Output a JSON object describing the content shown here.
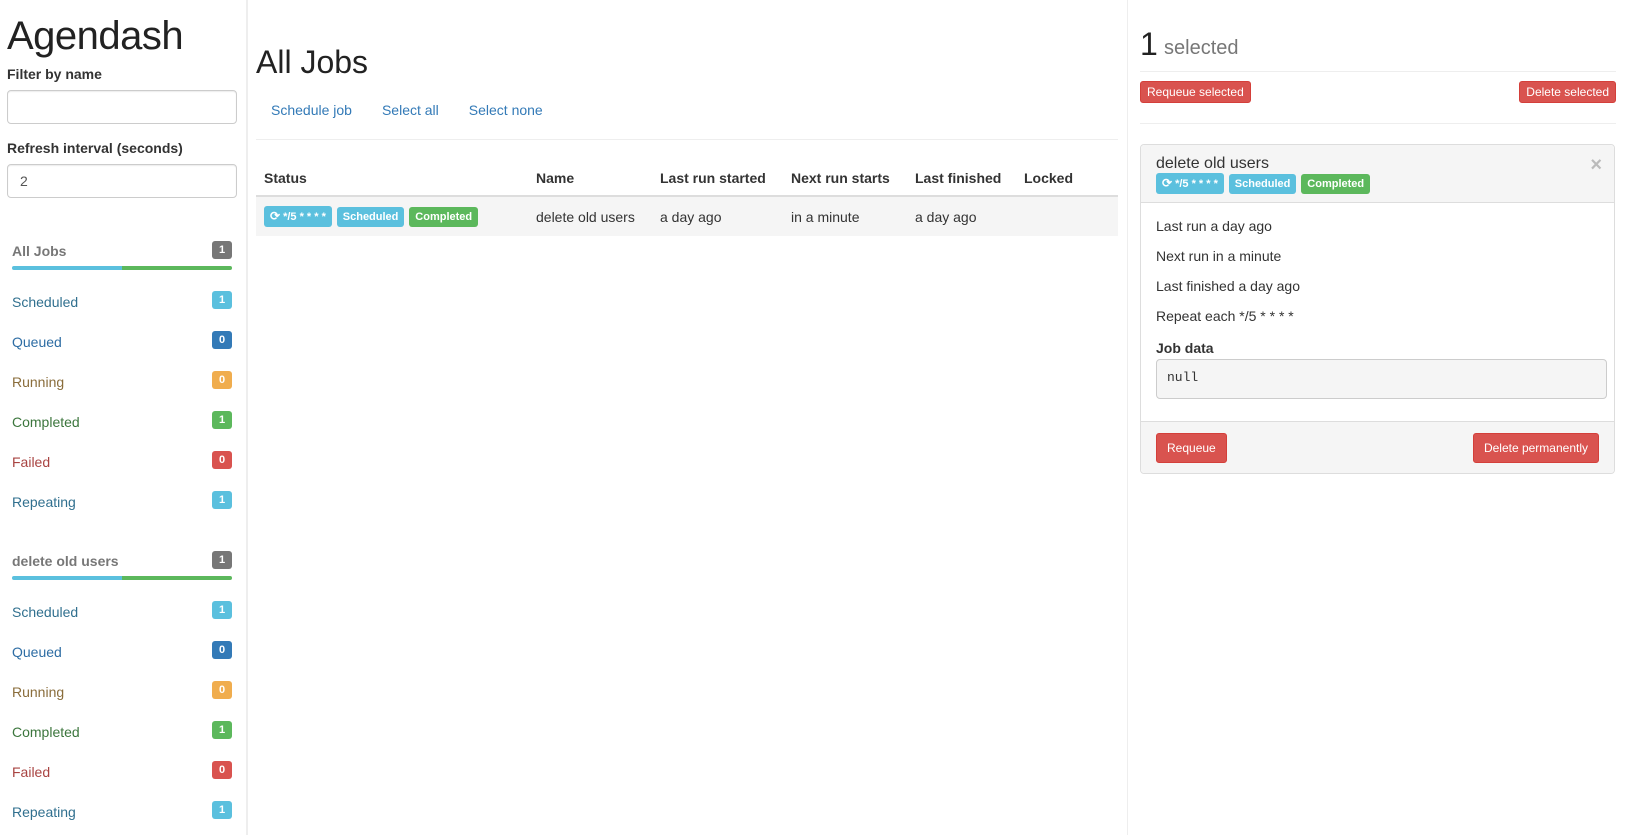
{
  "sidebar": {
    "brand": "Agendash",
    "filter_label": "Filter by name",
    "filter_value": "",
    "refresh_label": "Refresh interval (seconds)",
    "refresh_value": "2",
    "groups": [
      {
        "title": "All Jobs",
        "count": "1",
        "progress": {
          "scheduled": 0.5,
          "completed": 0.5
        },
        "statuses": [
          {
            "label": "Scheduled",
            "count": "1"
          },
          {
            "label": "Queued",
            "count": "0"
          },
          {
            "label": "Running",
            "count": "0"
          },
          {
            "label": "Completed",
            "count": "1"
          },
          {
            "label": "Failed",
            "count": "0"
          },
          {
            "label": "Repeating",
            "count": "1"
          }
        ]
      },
      {
        "title": "delete old users",
        "count": "1",
        "progress": {
          "scheduled": 0.5,
          "completed": 0.5
        },
        "statuses": [
          {
            "label": "Scheduled",
            "count": "1"
          },
          {
            "label": "Queued",
            "count": "0"
          },
          {
            "label": "Running",
            "count": "0"
          },
          {
            "label": "Completed",
            "count": "1"
          },
          {
            "label": "Failed",
            "count": "0"
          },
          {
            "label": "Repeating",
            "count": "1"
          }
        ]
      }
    ]
  },
  "main": {
    "title": "All Jobs",
    "actions": [
      "Schedule job",
      "Select all",
      "Select none"
    ],
    "columns": [
      "Status",
      "Name",
      "Last run started",
      "Next run starts",
      "Last finished",
      "Locked"
    ],
    "rows": [
      {
        "repeat": "*/5 * * * *",
        "badge_scheduled": "Scheduled",
        "badge_completed": "Completed",
        "name": "delete old users",
        "last_run_started": "a day ago",
        "next_run_starts": "in a minute",
        "last_finished": "a day ago",
        "locked": ""
      }
    ]
  },
  "right": {
    "selected_count": "1",
    "selected_text": "selected",
    "requeue_selected": "Requeue selected",
    "delete_selected": "Delete selected",
    "detail": {
      "title": "delete old users",
      "repeat": "*/5 * * * *",
      "badge_scheduled": "Scheduled",
      "badge_completed": "Completed",
      "close": "×",
      "last_run": "Last run a day ago",
      "next_run": "Next run in a minute",
      "last_finished": "Last finished a day ago",
      "repeat_each": "Repeat each */5 * * * *",
      "job_data_label": "Job data",
      "job_data": "null",
      "requeue": "Requeue",
      "delete": "Delete permanently"
    }
  },
  "colors": {
    "info": "#5bc0de",
    "primary": "#337ab7",
    "warning": "#f0ad4e",
    "success": "#5cb85c",
    "danger": "#d9534f",
    "default": "#777777"
  }
}
